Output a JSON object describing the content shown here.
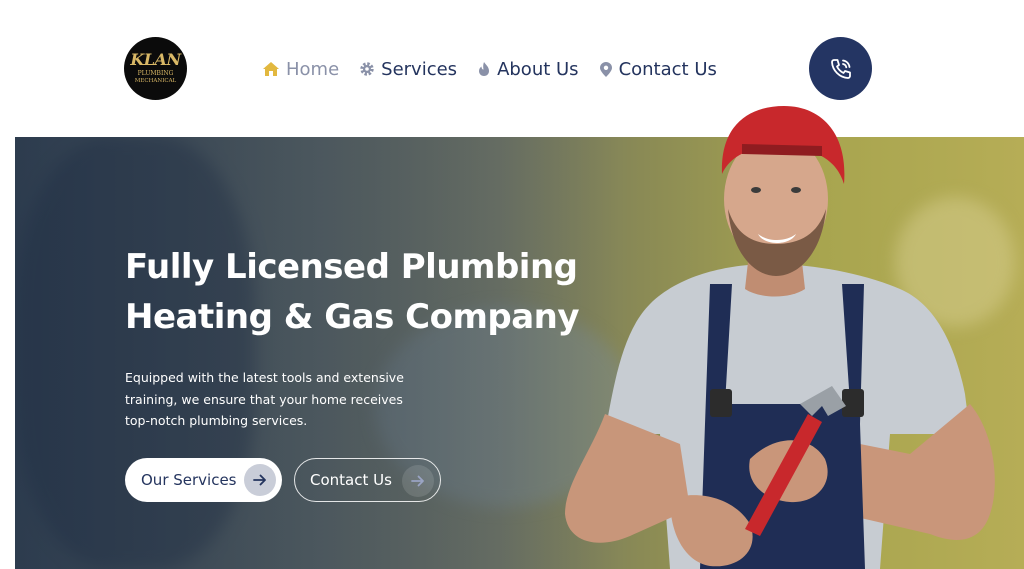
{
  "brand": {
    "logo_line1": "KLAN",
    "logo_line2": "PLUMBING",
    "logo_line3": "MECHANICAL"
  },
  "nav": {
    "items": [
      {
        "label": "Home",
        "icon": "home-icon",
        "active": true
      },
      {
        "label": "Services",
        "icon": "gear-icon",
        "active": false
      },
      {
        "label": "About Us",
        "icon": "flame-icon",
        "active": false
      },
      {
        "label": "Contact Us",
        "icon": "location-pin-icon",
        "active": false
      }
    ]
  },
  "phone_button": {
    "icon": "phone-call-icon"
  },
  "hero": {
    "headline_line1": "Fully Licensed Plumbing",
    "headline_line2": "Heating & Gas Company",
    "subtext_line1": "Equipped with the latest tools and extensive",
    "subtext_line2": "training, we ensure that your home receives",
    "subtext_line3": "top-notch plumbing services.",
    "primary_button": "Our Services",
    "secondary_button": "Contact Us",
    "image": "smiling-plumber-with-wrench"
  },
  "colors": {
    "navy": "#243563",
    "nav_text": "#24345e",
    "home_icon": "#e2b83f",
    "logo_gold": "#d9b866",
    "cap_red": "#c8282c"
  }
}
